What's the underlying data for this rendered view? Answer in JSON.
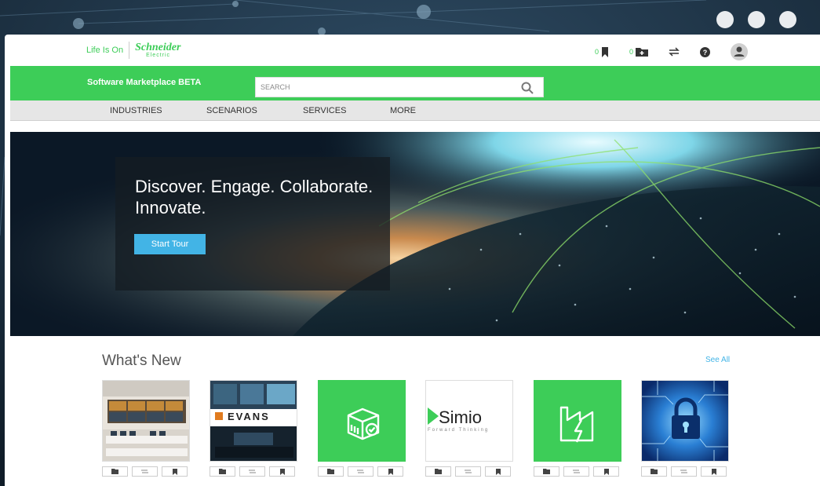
{
  "header": {
    "tagline": "Life Is On",
    "brand_name": "Schneider",
    "brand_sub": "Electric",
    "bookmark_count": "0",
    "folder_count": "0"
  },
  "marketplace": {
    "title": "Software Marketplace BETA",
    "search_placeholder": "SEARCH"
  },
  "nav": {
    "items": [
      "INDUSTRIES",
      "SCENARIOS",
      "SERVICES",
      "MORE"
    ]
  },
  "hero": {
    "title": "Discover. Engage. Collaborate. Innovate.",
    "button_label": "Start Tour"
  },
  "whats_new": {
    "heading": "What's New",
    "see_all": "See All",
    "cards": [
      {
        "kind": "control-room-photo"
      },
      {
        "kind": "evans-logo",
        "logo_text": "EVANS"
      },
      {
        "kind": "package-icon"
      },
      {
        "kind": "simio-logo",
        "logo_text": "Simio",
        "tagline": "Forward Thinking"
      },
      {
        "kind": "factory-icon"
      },
      {
        "kind": "security-lock-image"
      }
    ]
  },
  "colors": {
    "accent_green": "#3dcd58",
    "accent_blue": "#42b4e6"
  }
}
